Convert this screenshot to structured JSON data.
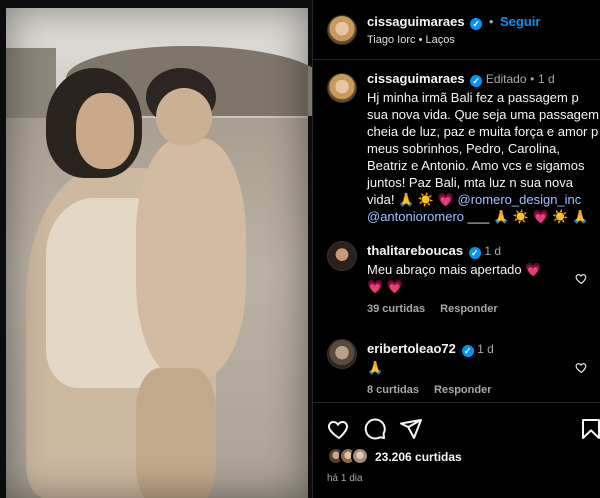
{
  "post": {
    "author": "cissaguimaraes",
    "follow_label": "Seguir",
    "audio": "Tiago Iorc",
    "audio_separator": "•",
    "audio_track": "Laços"
  },
  "caption": {
    "author": "cissaguimaraes",
    "edited_label": "Editado",
    "time": "1 d",
    "text": "Hj minha irmã Bali fez a passagem p sua nova vida. Que seja uma passagem cheia de luz, paz e muita força e amor p meus sobrinhos, Pedro, Carolina, Beatriz e Antonio. Amo vcs e sigamos juntos! Paz Bali, mta luz n sua nova vida!",
    "emojis_line1": "🙏 ☀️ 💗",
    "mention1": "@romero_design_inc",
    "mention2": "@antonioromero",
    "trailing": "___",
    "emojis_line2": "🙏 ☀️ 💗 ☀️ 🙏"
  },
  "comments": [
    {
      "author": "thalitareboucas",
      "time": "1 d",
      "text": "Meu abraço mais apertado 💗",
      "text_line2": "💗 💗",
      "likes": "39 curtidas",
      "reply_label": "Responder"
    },
    {
      "author": "eribertoleao72",
      "time": "1 d",
      "text": "🙏",
      "likes": "8 curtidas",
      "reply_label": "Responder"
    }
  ],
  "footer": {
    "likes": "23.206 curtidas",
    "time": "há 1 dia"
  },
  "icons": {
    "like": "heart-icon",
    "comment": "comment-icon",
    "share": "share-icon",
    "save": "bookmark-icon",
    "more": "more-icon",
    "verified": "verified-icon"
  },
  "colors": {
    "background": "#000000",
    "accent": "#0095f6",
    "text": "#f5f5f5",
    "muted": "#a8a8a8",
    "border": "#262626"
  }
}
